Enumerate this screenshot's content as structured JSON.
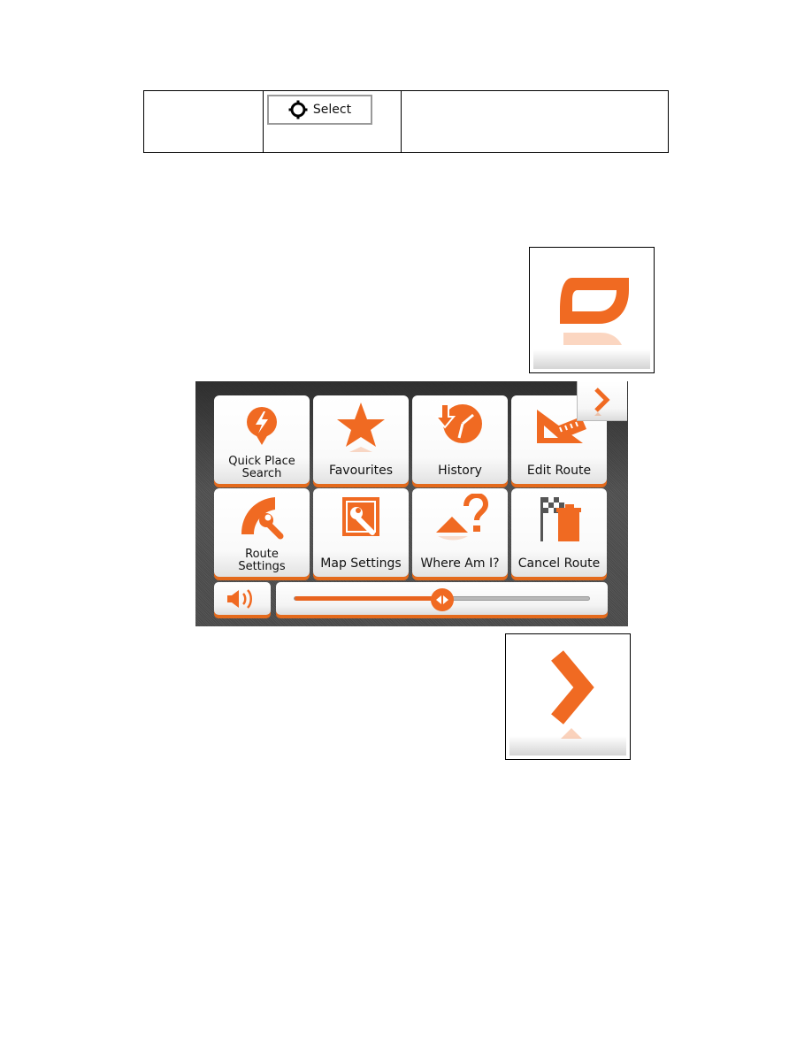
{
  "doc_table": {
    "select_button": {
      "label": "Select",
      "icon": "crosshair-target-icon"
    }
  },
  "icons": {
    "back_button_icon": "back-arrow-icon",
    "next_button_icon": "chevron-right-icon"
  },
  "menu": {
    "accent_color": "#f06a22",
    "tiles": [
      {
        "label_line1": "Quick Place",
        "label_line2": "Search",
        "icon": "lightning-pin-icon"
      },
      {
        "label": "Favourites",
        "icon": "star-icon"
      },
      {
        "label": "History",
        "icon": "history-clock-icon"
      },
      {
        "label": "Edit Route",
        "icon": "ruler-triangle-icon"
      },
      {
        "label_line1": "Route",
        "label_line2": "Settings",
        "icon": "route-wrench-icon"
      },
      {
        "label": "Map Settings",
        "icon": "map-wrench-icon"
      },
      {
        "label": "Where Am I?",
        "icon": "position-question-icon"
      },
      {
        "label": "Cancel Route",
        "icon": "flag-bin-icon"
      }
    ],
    "volume": {
      "icon": "speaker-icon",
      "level_percent": 50
    }
  }
}
